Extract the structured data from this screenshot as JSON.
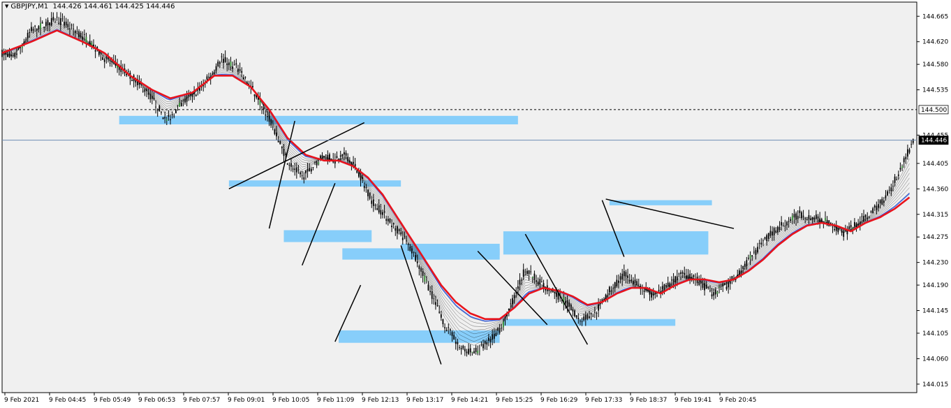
{
  "header": {
    "symbol": "GBPJPY,M1",
    "open": "144.426",
    "high": "144.461",
    "low": "144.425",
    "close": "144.446"
  },
  "colors": {
    "background": "#f0f0f0",
    "grid_border": "#000000",
    "candle": "#000000",
    "bull_accent": "#2e8b2e",
    "slow_ma": "#e8141c",
    "fast_ma": "#4169e1",
    "ribbon": "#000000",
    "zone": "#87cefa",
    "current_price_line": "#6e8db4",
    "level_line": "#000000"
  },
  "chart_data": {
    "type": "candlestick",
    "symbol": "GBPJPY",
    "timeframe": "M1",
    "y_ticks": [
      "144.665",
      "144.620",
      "144.580",
      "144.535",
      "144.500",
      "144.455",
      "144.446",
      "144.405",
      "144.360",
      "144.315",
      "144.275",
      "144.230",
      "144.190",
      "144.145",
      "144.105",
      "144.060",
      "144.015"
    ],
    "x_ticks": [
      "9 Feb 2021",
      "9 Feb 04:45",
      "9 Feb 05:49",
      "9 Feb 06:53",
      "9 Feb 07:57",
      "9 Feb 09:01",
      "9 Feb 10:05",
      "9 Feb 11:09",
      "9 Feb 12:13",
      "9 Feb 13:17",
      "9 Feb 14:21",
      "9 Feb 15:25",
      "9 Feb 16:29",
      "9 Feb 17:33",
      "9 Feb 18:37",
      "9 Feb 19:41",
      "9 Feb 20:45"
    ],
    "ylim": [
      144.0,
      144.69
    ],
    "current_price": "144.446",
    "level_price": "144.500",
    "price_path": [
      [
        0,
        144.6
      ],
      [
        3,
        144.59
      ],
      [
        8,
        144.64
      ],
      [
        15,
        144.66
      ],
      [
        20,
        144.64
      ],
      [
        24,
        144.62
      ],
      [
        28,
        144.59
      ],
      [
        33,
        144.57
      ],
      [
        37,
        144.55
      ],
      [
        41,
        144.52
      ],
      [
        45,
        144.48
      ],
      [
        49,
        144.51
      ],
      [
        53,
        144.53
      ],
      [
        57,
        144.56
      ],
      [
        60,
        144.59
      ],
      [
        64,
        144.575
      ],
      [
        68,
        144.54
      ],
      [
        71,
        144.51
      ],
      [
        74,
        144.47
      ],
      [
        78,
        144.41
      ],
      [
        82,
        144.38
      ],
      [
        85,
        144.4
      ],
      [
        88,
        144.42
      ],
      [
        91,
        144.41
      ],
      [
        94,
        144.42
      ],
      [
        97,
        144.395
      ],
      [
        101,
        144.34
      ],
      [
        105,
        144.31
      ],
      [
        109,
        144.28
      ],
      [
        113,
        144.24
      ],
      [
        117,
        144.18
      ],
      [
        121,
        144.12
      ],
      [
        125,
        144.08
      ],
      [
        129,
        144.07
      ],
      [
        133,
        144.09
      ],
      [
        137,
        144.12
      ],
      [
        140,
        144.17
      ],
      [
        143,
        144.22
      ],
      [
        146,
        144.2
      ],
      [
        150,
        144.18
      ],
      [
        154,
        144.16
      ],
      [
        158,
        144.13
      ],
      [
        162,
        144.14
      ],
      [
        166,
        144.18
      ],
      [
        170,
        144.21
      ],
      [
        174,
        144.19
      ],
      [
        178,
        144.17
      ],
      [
        182,
        144.19
      ],
      [
        186,
        144.21
      ],
      [
        190,
        144.2
      ],
      [
        194,
        144.175
      ],
      [
        198,
        144.19
      ],
      [
        202,
        144.215
      ],
      [
        206,
        144.25
      ],
      [
        210,
        144.28
      ],
      [
        214,
        144.3
      ],
      [
        218,
        144.315
      ],
      [
        222,
        144.31
      ],
      [
        226,
        144.3
      ],
      [
        230,
        144.28
      ],
      [
        234,
        144.3
      ],
      [
        238,
        144.32
      ],
      [
        242,
        144.35
      ],
      [
        246,
        144.4
      ],
      [
        249,
        144.446
      ]
    ],
    "red_ma_path": [
      [
        0,
        144.6
      ],
      [
        8,
        144.62
      ],
      [
        15,
        144.64
      ],
      [
        22,
        144.62
      ],
      [
        28,
        144.6
      ],
      [
        35,
        144.56
      ],
      [
        41,
        144.535
      ],
      [
        46,
        144.52
      ],
      [
        52,
        144.53
      ],
      [
        58,
        144.56
      ],
      [
        63,
        144.56
      ],
      [
        68,
        144.54
      ],
      [
        73,
        144.5
      ],
      [
        78,
        144.45
      ],
      [
        83,
        144.42
      ],
      [
        88,
        144.41
      ],
      [
        92,
        144.41
      ],
      [
        96,
        144.4
      ],
      [
        100,
        144.38
      ],
      [
        104,
        144.35
      ],
      [
        108,
        144.31
      ],
      [
        112,
        144.27
      ],
      [
        116,
        144.23
      ],
      [
        120,
        144.19
      ],
      [
        124,
        144.16
      ],
      [
        128,
        144.14
      ],
      [
        132,
        144.13
      ],
      [
        136,
        144.13
      ],
      [
        140,
        144.15
      ],
      [
        144,
        144.175
      ],
      [
        148,
        144.185
      ],
      [
        152,
        144.18
      ],
      [
        156,
        144.17
      ],
      [
        160,
        144.155
      ],
      [
        164,
        144.16
      ],
      [
        168,
        144.175
      ],
      [
        172,
        144.185
      ],
      [
        176,
        144.185
      ],
      [
        180,
        144.175
      ],
      [
        184,
        144.19
      ],
      [
        188,
        144.2
      ],
      [
        192,
        144.2
      ],
      [
        196,
        144.195
      ],
      [
        200,
        144.2
      ],
      [
        204,
        144.215
      ],
      [
        208,
        144.235
      ],
      [
        212,
        144.26
      ],
      [
        216,
        144.28
      ],
      [
        220,
        144.295
      ],
      [
        224,
        144.3
      ],
      [
        228,
        144.295
      ],
      [
        232,
        144.285
      ],
      [
        236,
        144.3
      ],
      [
        240,
        144.31
      ],
      [
        244,
        144.325
      ],
      [
        248,
        144.345
      ]
    ],
    "zones": [
      {
        "from": 32,
        "to": 141,
        "lo": 144.474,
        "hi": 144.489
      },
      {
        "from": 62,
        "to": 109,
        "lo": 144.364,
        "hi": 144.375
      },
      {
        "from": 77,
        "to": 101,
        "lo": 144.266,
        "hi": 144.287
      },
      {
        "from": 93,
        "to": 136,
        "lo": 144.235,
        "hi": 144.255
      },
      {
        "from": 109,
        "to": 136,
        "lo": 144.243,
        "hi": 144.263
      },
      {
        "from": 92,
        "to": 136,
        "lo": 144.088,
        "hi": 144.11
      },
      {
        "from": 137,
        "to": 184,
        "lo": 144.118,
        "hi": 144.13
      },
      {
        "from": 137,
        "to": 193,
        "lo": 144.244,
        "hi": 144.285
      },
      {
        "from": 175,
        "to": 193,
        "lo": 144.246,
        "hi": 144.285
      },
      {
        "from": 166,
        "to": 194,
        "lo": 144.331,
        "hi": 144.34
      }
    ],
    "trendlines": [
      [
        [
          62,
          144.36
        ],
        [
          99,
          144.477
        ]
      ],
      [
        [
          73,
          144.29
        ],
        [
          80,
          144.48
        ]
      ],
      [
        [
          82,
          144.225
        ],
        [
          91,
          144.37
        ]
      ],
      [
        [
          91,
          144.09
        ],
        [
          98,
          144.19
        ]
      ],
      [
        [
          109,
          144.26
        ],
        [
          120,
          144.05
        ]
      ],
      [
        [
          130,
          144.25
        ],
        [
          149,
          144.12
        ]
      ],
      [
        [
          143,
          144.28
        ],
        [
          160,
          144.085
        ]
      ],
      [
        [
          165,
          144.342
        ],
        [
          200,
          144.29
        ]
      ],
      [
        [
          164,
          144.34
        ],
        [
          170,
          144.24
        ]
      ]
    ]
  }
}
